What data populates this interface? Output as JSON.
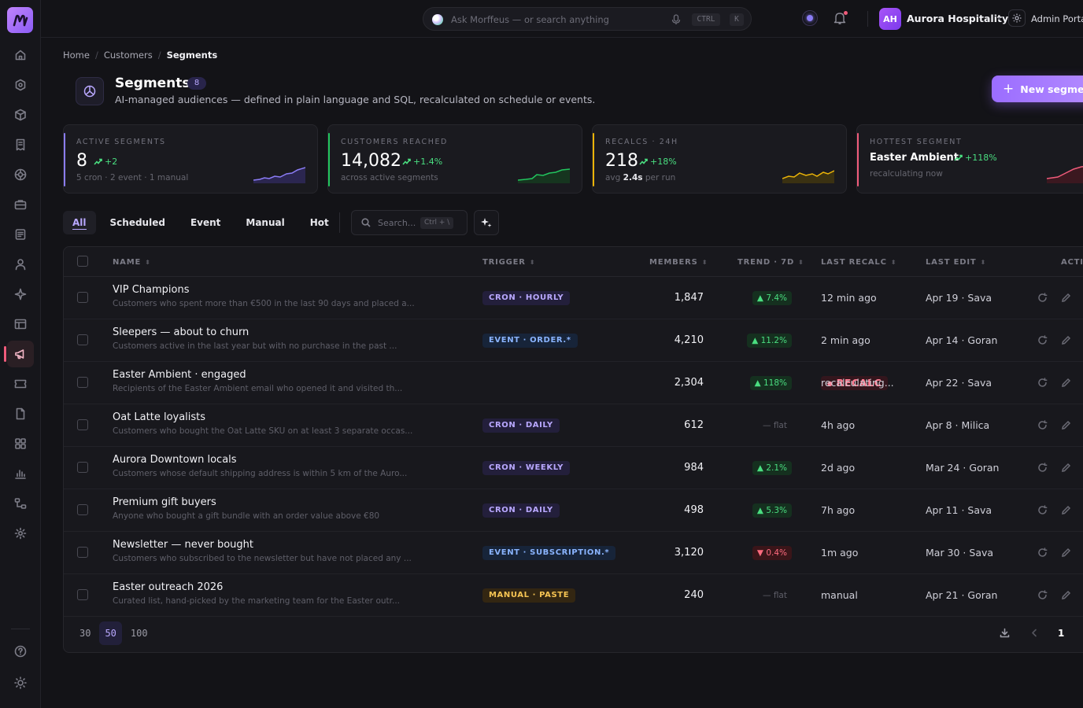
{
  "topbar": {
    "search_placeholder": "Ask Morffeus — or search anything",
    "kbd_ctrl": "CTRL",
    "kbd_k": "K",
    "avatar_initials": "AH",
    "org_name": "Aurora Hospitality",
    "admin_label": "Admin Portal"
  },
  "breadcrumb": [
    "Home",
    "Customers",
    "Segments"
  ],
  "header": {
    "title": "Segments",
    "count": "8",
    "subtitle": "AI-managed audiences — defined in plain language and SQL, recalculated on schedule or events.",
    "new_button": "New segment"
  },
  "stats": [
    {
      "label": "ACTIVE SEGMENTS",
      "value": "8",
      "delta": "+2",
      "sub": "5 cron · 2 event · 1 manual",
      "color": "#8b7cf6"
    },
    {
      "label": "CUSTOMERS REACHED",
      "value": "14,082",
      "delta": "+1.4%",
      "sub": "across active segments",
      "color": "#22c55e"
    },
    {
      "label": "RECALCS · 24H",
      "value": "218",
      "delta": "+18%",
      "sub_prefix": "avg",
      "sub_value": "2.4s",
      "sub_suffix": "per run",
      "color": "#eab308"
    },
    {
      "label": "HOTTEST SEGMENT",
      "value": "Easter Ambient",
      "delta": "+118%",
      "sub": "recalculating now",
      "color": "#ef5b7a"
    }
  ],
  "tabs": [
    "All",
    "Scheduled",
    "Event",
    "Manual",
    "Hot"
  ],
  "table_search": {
    "placeholder": "Search...",
    "shortcut": "Ctrl + \\"
  },
  "columns": {
    "name": "NAME",
    "trigger": "TRIGGER",
    "members": "MEMBERS",
    "trend": "TREND · 7D",
    "last_recalc": "LAST RECALC",
    "last_edit": "LAST EDIT",
    "actions": "ACTIONS"
  },
  "rows": [
    {
      "name": "VIP Champions",
      "desc": "Customers who spent more than €500 in the last 90 days and placed a...",
      "trigger": "CRON · HOURLY",
      "trigger_type": "cron",
      "members": "1,847",
      "trend": "▲ 7.4%",
      "trend_dir": "up",
      "recalc": "12 min ago",
      "edit": "Apr 19 · Sava"
    },
    {
      "name": "Sleepers — about to churn",
      "desc": "Customers active in the last year but with no purchase in the past ...",
      "trigger": "EVENT · ORDER.*",
      "trigger_type": "event",
      "members": "4,210",
      "trend": "▲ 11.2%",
      "trend_dir": "up",
      "recalc": "2 min ago",
      "edit": "Apr 14 · Goran"
    },
    {
      "name": "Easter Ambient · engaged",
      "desc": "Recipients of the Easter Ambient email who opened it and visited th...",
      "trigger": "RECALC",
      "trigger_type": "recalc",
      "members": "2,304",
      "trend": "▲ 118%",
      "trend_dir": "up",
      "recalc": "recalculating...",
      "edit": "Apr 22 · Sava"
    },
    {
      "name": "Oat Latte loyalists",
      "desc": "Customers who bought the Oat Latte SKU on at least 3 separate occas...",
      "trigger": "CRON · DAILY",
      "trigger_type": "cron",
      "members": "612",
      "trend": "— flat",
      "trend_dir": "flat",
      "recalc": "4h ago",
      "edit": "Apr 8 · Milica"
    },
    {
      "name": "Aurora Downtown locals",
      "desc": "Customers whose default shipping address is within 5 km of the Auro...",
      "trigger": "CRON · WEEKLY",
      "trigger_type": "cron",
      "members": "984",
      "trend": "▲ 2.1%",
      "trend_dir": "up",
      "recalc": "2d ago",
      "edit": "Mar 24 · Goran"
    },
    {
      "name": "Premium gift buyers",
      "desc": "Anyone who bought a gift bundle with an order value above €80",
      "trigger": "CRON · DAILY",
      "trigger_type": "cron",
      "members": "498",
      "trend": "▲ 5.3%",
      "trend_dir": "up",
      "recalc": "7h ago",
      "edit": "Apr 11 · Sava"
    },
    {
      "name": "Newsletter — never bought",
      "desc": "Customers who subscribed to the newsletter but have not placed any ...",
      "trigger": "EVENT · SUBSCRIPTION.*",
      "trigger_type": "event",
      "members": "3,120",
      "trend": "▼ 0.4%",
      "trend_dir": "down",
      "recalc": "1m ago",
      "edit": "Mar 30 · Sava"
    },
    {
      "name": "Easter outreach 2026",
      "desc": "Curated list, hand-picked by the marketing team for the Easter outr...",
      "trigger": "MANUAL · PASTE",
      "trigger_type": "manual",
      "members": "240",
      "trend": "— flat",
      "trend_dir": "flat",
      "recalc": "manual",
      "edit": "Apr 21 · Goran"
    }
  ],
  "page_sizes": [
    "30",
    "50",
    "100"
  ],
  "page_size_selected": "50",
  "current_page": "1"
}
